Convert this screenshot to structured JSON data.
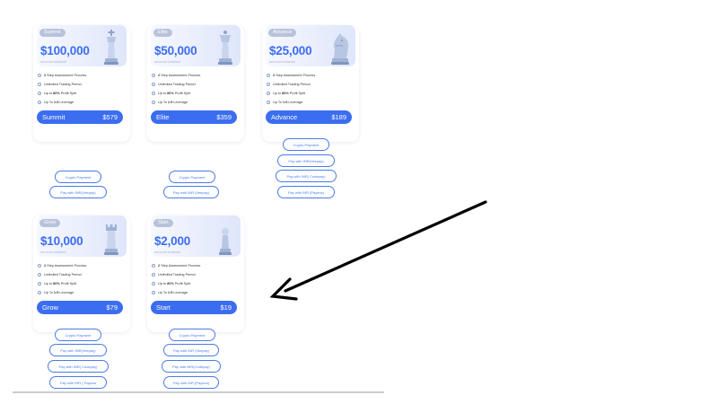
{
  "cards": [
    {
      "badge": "Summit",
      "amount": "$100,000",
      "sub": "account balance",
      "piece": "king",
      "f1b": "2",
      "f1": "Step Assessment Process",
      "f2": "Unlimited Trading Period",
      "f3a": "Up to",
      "f3b": "80%",
      "f3c": "Profit Split",
      "f4a": "Up To",
      "f4b": "1:5",
      "f4c": "Leverage",
      "name": "Summit",
      "price": "$579"
    },
    {
      "badge": "Elite",
      "amount": "$50,000",
      "sub": "account balance",
      "piece": "queen",
      "f1b": "2",
      "f1": "Step Assessment Process",
      "f2": "Unlimited Trading Period",
      "f3a": "Up to",
      "f3b": "80%",
      "f3c": "Profit Split",
      "f4a": "Up To",
      "f4b": "1:5",
      "f4c": "Leverage",
      "name": "Elite",
      "price": "$359"
    },
    {
      "badge": "Advance",
      "amount": "$25,000",
      "sub": "account balance",
      "piece": "knight",
      "f1b": "2",
      "f1": "Step Assessment Process",
      "f2": "Unlimited Trading Period",
      "f3a": "Up to",
      "f3b": "80%",
      "f3c": "Profit Split",
      "f4a": "Up To",
      "f4b": "1:5",
      "f4c": "Leverage",
      "name": "Advance",
      "price": "$189"
    },
    {
      "badge": "Grow",
      "amount": "$10,000",
      "sub": "account balance",
      "piece": "rook",
      "f1b": "2",
      "f1": "Step Assessment Process",
      "f2": "Unlimited Trading Period",
      "f3a": "Up to",
      "f3b": "80%",
      "f3c": "Profit Split",
      "f4a": "Up To",
      "f4b": "1:5",
      "f4c": "Leverage",
      "name": "Grow",
      "price": "$79"
    },
    {
      "badge": "Start",
      "amount": "$2,000",
      "sub": "account balance",
      "piece": "pawn",
      "f1b": "2",
      "f1": "Step Assessment Process",
      "f2": "Unlimited Trading Period",
      "f3a": "Up to",
      "f3b": "80%",
      "f3c": "Profit Split",
      "f4a": "Up To",
      "f4b": "1:5",
      "f4c": "Leverage",
      "name": "Start",
      "price": "$19"
    }
  ],
  "payments": {
    "summit": [
      "Crypto Payment",
      "Pay with INR(Veepay)"
    ],
    "elite": [
      "Crypto Payment",
      "Pay with INR (Veepay)"
    ],
    "advance": [
      "Crypto Payment",
      "Pay with INR(Veepay)",
      "Pay with INR( Codepay)",
      "Pay with INR (Payeos)"
    ],
    "grow": [
      "Crypto Payment",
      "Pay with INR(Veepay)",
      "Pay with INR( Codepay)",
      "Pay with INR ( Payeos"
    ],
    "start": [
      "Crypto Payment",
      "Pay with INR (Veepay)",
      "Pay with INR(Codepay)",
      "Pay with INR (Payeos)"
    ]
  },
  "annotation": {
    "arrow_color": "#000000"
  },
  "colors": {
    "accent": "#3b6df0"
  }
}
